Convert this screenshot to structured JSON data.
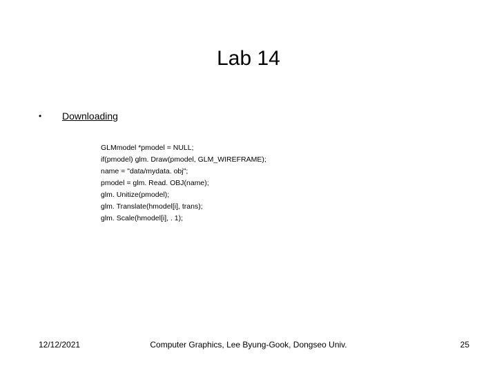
{
  "title": "Lab 14",
  "bullet": {
    "marker": "•",
    "label": "Downloading"
  },
  "code": {
    "l1": "GLMmodel *pmodel = NULL;",
    "l2": "if(pmodel) glm. Draw(pmodel, GLM_WIREFRAME);",
    "l3": "name = \"data/mydata. obj\";",
    "l4": "pmodel = glm. Read. OBJ(name);",
    "l5": "glm. Unitize(pmodel);",
    "l6": "glm. Translate(hmodel[i], trans);",
    "l7": "glm. Scale(hmodel[i], . 1);"
  },
  "footer": {
    "date": "12/12/2021",
    "center": "Computer Graphics, Lee Byung-Gook, Dongseo Univ.",
    "page": "25"
  }
}
